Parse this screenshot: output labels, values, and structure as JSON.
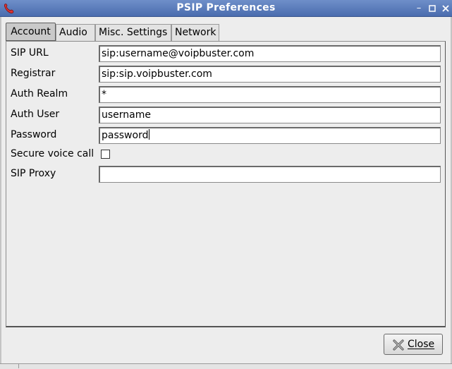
{
  "window": {
    "title": "PSIP Preferences",
    "app_icon": "phone-icon",
    "controls": [
      "minimize-icon",
      "maximize-icon",
      "close-icon"
    ]
  },
  "tabs": [
    {
      "label": "Account",
      "active": true
    },
    {
      "label": "Audio",
      "active": false
    },
    {
      "label": "Misc. Settings",
      "active": false
    },
    {
      "label": "Network",
      "active": false
    }
  ],
  "account": {
    "sip_url": {
      "label": "SIP URL",
      "value": "sip:username@voipbuster.com"
    },
    "registrar": {
      "label": "Registrar",
      "value": "sip:sip.voipbuster.com"
    },
    "auth_realm": {
      "label": "Auth Realm",
      "value": "*"
    },
    "auth_user": {
      "label": "Auth User",
      "value": "username"
    },
    "password": {
      "label": "Password",
      "value": "password"
    },
    "secure_voice_call": {
      "label": "Secure voice call",
      "checked": false
    },
    "sip_proxy": {
      "label": "SIP Proxy",
      "value": ""
    }
  },
  "buttons": {
    "close_label": "Close",
    "close_icon": "x-icon"
  },
  "colors": {
    "titlebar": "#5a7cbd",
    "window_bg": "#ededed",
    "active_tab": "#c9c9c9"
  }
}
